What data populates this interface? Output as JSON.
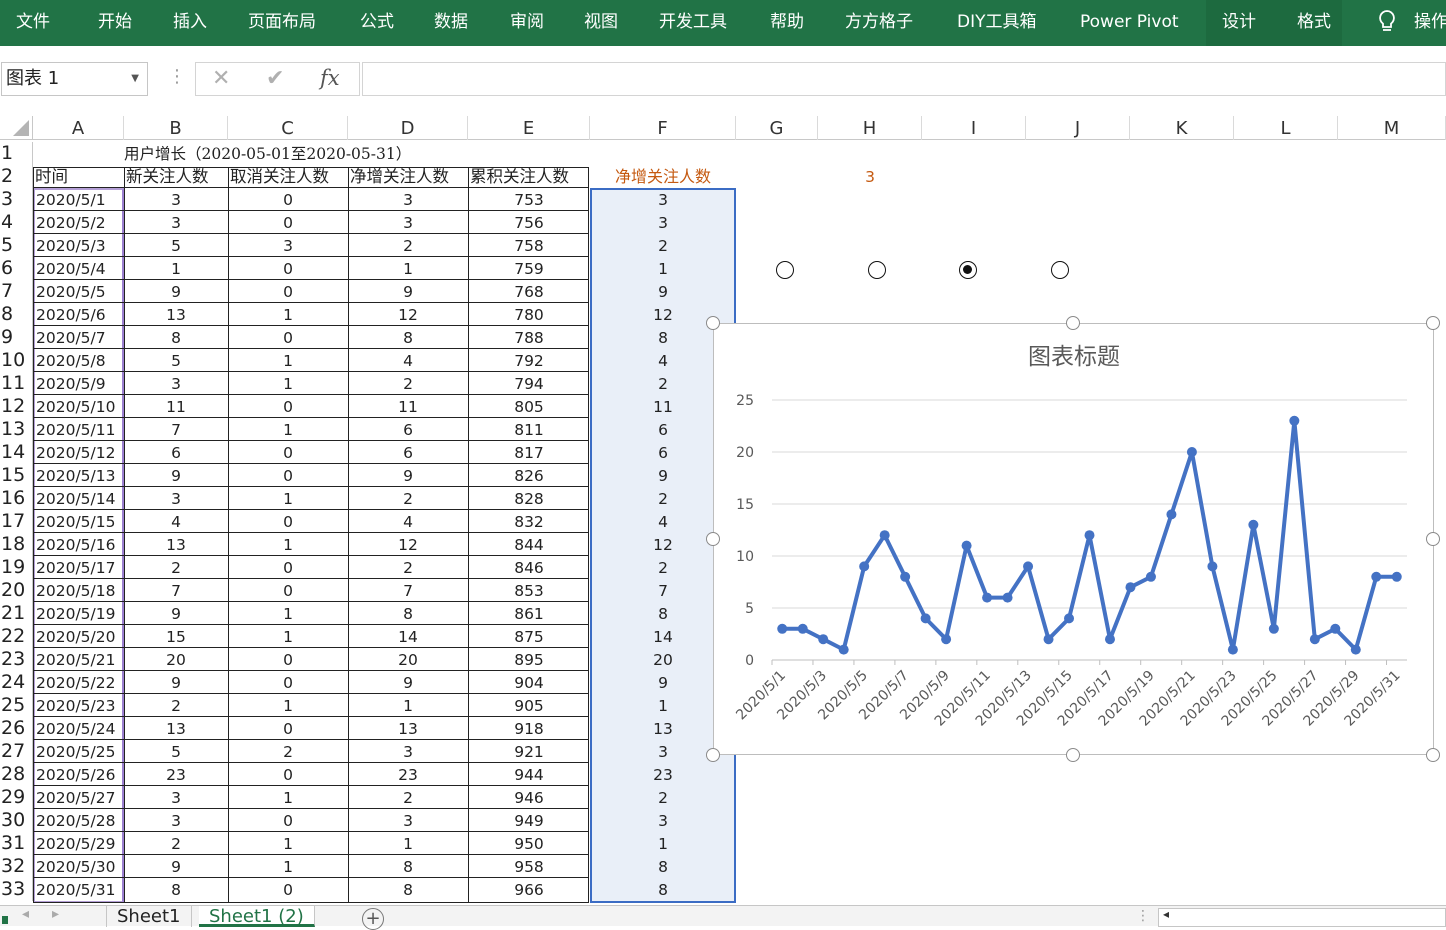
{
  "ribbon": {
    "tabs": [
      "文件",
      "开始",
      "插入",
      "页面布局",
      "公式",
      "数据",
      "审阅",
      "视图",
      "开发工具",
      "帮助",
      "方方格子",
      "DIY工具箱",
      "Power Pivot",
      "设计",
      "格式",
      "操作"
    ],
    "selected": [
      "设计",
      "格式"
    ],
    "bg_color": "#217346"
  },
  "formula_bar": {
    "name_box": "图表 1",
    "cancel_icon": "✕",
    "enter_icon": "✔",
    "fx_label": "fx",
    "value": ""
  },
  "columns": [
    "A",
    "B",
    "C",
    "D",
    "E",
    "F",
    "G",
    "H",
    "I",
    "J",
    "K",
    "L",
    "M"
  ],
  "sheet": {
    "title": "用户增长（2020-05-01至2020-05-31）",
    "headers": [
      "时间",
      "新关注人数",
      "取消关注人数",
      "净增关注人数",
      "累积关注人数"
    ],
    "f2_label": "净增关注人数",
    "h2_value": "3",
    "rows": [
      [
        "2020/5/1",
        "3",
        "0",
        "3",
        "753",
        "3"
      ],
      [
        "2020/5/2",
        "3",
        "0",
        "3",
        "756",
        "3"
      ],
      [
        "2020/5/3",
        "5",
        "3",
        "2",
        "758",
        "2"
      ],
      [
        "2020/5/4",
        "1",
        "0",
        "1",
        "759",
        "1"
      ],
      [
        "2020/5/5",
        "9",
        "0",
        "9",
        "768",
        "9"
      ],
      [
        "2020/5/6",
        "13",
        "1",
        "12",
        "780",
        "12"
      ],
      [
        "2020/5/7",
        "8",
        "0",
        "8",
        "788",
        "8"
      ],
      [
        "2020/5/8",
        "5",
        "1",
        "4",
        "792",
        "4"
      ],
      [
        "2020/5/9",
        "3",
        "1",
        "2",
        "794",
        "2"
      ],
      [
        "2020/5/10",
        "11",
        "0",
        "11",
        "805",
        "11"
      ],
      [
        "2020/5/11",
        "7",
        "1",
        "6",
        "811",
        "6"
      ],
      [
        "2020/5/12",
        "6",
        "0",
        "6",
        "817",
        "6"
      ],
      [
        "2020/5/13",
        "9",
        "0",
        "9",
        "826",
        "9"
      ],
      [
        "2020/5/14",
        "3",
        "1",
        "2",
        "828",
        "2"
      ],
      [
        "2020/5/15",
        "4",
        "0",
        "4",
        "832",
        "4"
      ],
      [
        "2020/5/16",
        "13",
        "1",
        "12",
        "844",
        "12"
      ],
      [
        "2020/5/17",
        "2",
        "0",
        "2",
        "846",
        "2"
      ],
      [
        "2020/5/18",
        "7",
        "0",
        "7",
        "853",
        "7"
      ],
      [
        "2020/5/19",
        "9",
        "1",
        "8",
        "861",
        "8"
      ],
      [
        "2020/5/20",
        "15",
        "1",
        "14",
        "875",
        "14"
      ],
      [
        "2020/5/21",
        "20",
        "0",
        "20",
        "895",
        "20"
      ],
      [
        "2020/5/22",
        "9",
        "0",
        "9",
        "904",
        "9"
      ],
      [
        "2020/5/23",
        "2",
        "1",
        "1",
        "905",
        "1"
      ],
      [
        "2020/5/24",
        "13",
        "0",
        "13",
        "918",
        "13"
      ],
      [
        "2020/5/25",
        "5",
        "2",
        "3",
        "921",
        "3"
      ],
      [
        "2020/5/26",
        "23",
        "0",
        "23",
        "944",
        "23"
      ],
      [
        "2020/5/27",
        "3",
        "1",
        "2",
        "946",
        "2"
      ],
      [
        "2020/5/28",
        "3",
        "0",
        "3",
        "949",
        "3"
      ],
      [
        "2020/5/29",
        "2",
        "1",
        "1",
        "950",
        "1"
      ],
      [
        "2020/5/30",
        "9",
        "1",
        "8",
        "958",
        "8"
      ],
      [
        "2020/5/31",
        "8",
        "0",
        "8",
        "966",
        "8"
      ]
    ]
  },
  "option_buttons": [
    false,
    false,
    true,
    false
  ],
  "chart_data": {
    "type": "line",
    "title": "图表标题",
    "x": [
      "2020/5/1",
      "2020/5/2",
      "2020/5/3",
      "2020/5/4",
      "2020/5/5",
      "2020/5/6",
      "2020/5/7",
      "2020/5/8",
      "2020/5/9",
      "2020/5/10",
      "2020/5/11",
      "2020/5/12",
      "2020/5/13",
      "2020/5/14",
      "2020/5/15",
      "2020/5/16",
      "2020/5/17",
      "2020/5/18",
      "2020/5/19",
      "2020/5/20",
      "2020/5/21",
      "2020/5/22",
      "2020/5/23",
      "2020/5/24",
      "2020/5/25",
      "2020/5/26",
      "2020/5/27",
      "2020/5/28",
      "2020/5/29",
      "2020/5/30",
      "2020/5/31"
    ],
    "x_tick_labels": [
      "2020/5/1",
      "2020/5/3",
      "2020/5/5",
      "2020/5/7",
      "2020/5/9",
      "2020/5/11",
      "2020/5/13",
      "2020/5/15",
      "2020/5/17",
      "2020/5/19",
      "2020/5/21",
      "2020/5/23",
      "2020/5/25",
      "2020/5/27",
      "2020/5/29",
      "2020/5/31"
    ],
    "series": [
      {
        "values": [
          3,
          3,
          2,
          1,
          9,
          12,
          8,
          4,
          2,
          11,
          6,
          6,
          9,
          2,
          4,
          12,
          2,
          7,
          8,
          14,
          20,
          9,
          1,
          13,
          3,
          23,
          2,
          3,
          1,
          8,
          8
        ]
      }
    ],
    "ylim": [
      0,
      25
    ],
    "y_ticks": [
      "0",
      "5",
      "10",
      "15",
      "20",
      "25"
    ],
    "grid": true,
    "line_color": "#4472c4"
  },
  "sheet_tabs": {
    "tabs": [
      "Sheet1",
      "Sheet1 (2)"
    ],
    "active": "Sheet1 (2)",
    "add_icon": "+"
  }
}
